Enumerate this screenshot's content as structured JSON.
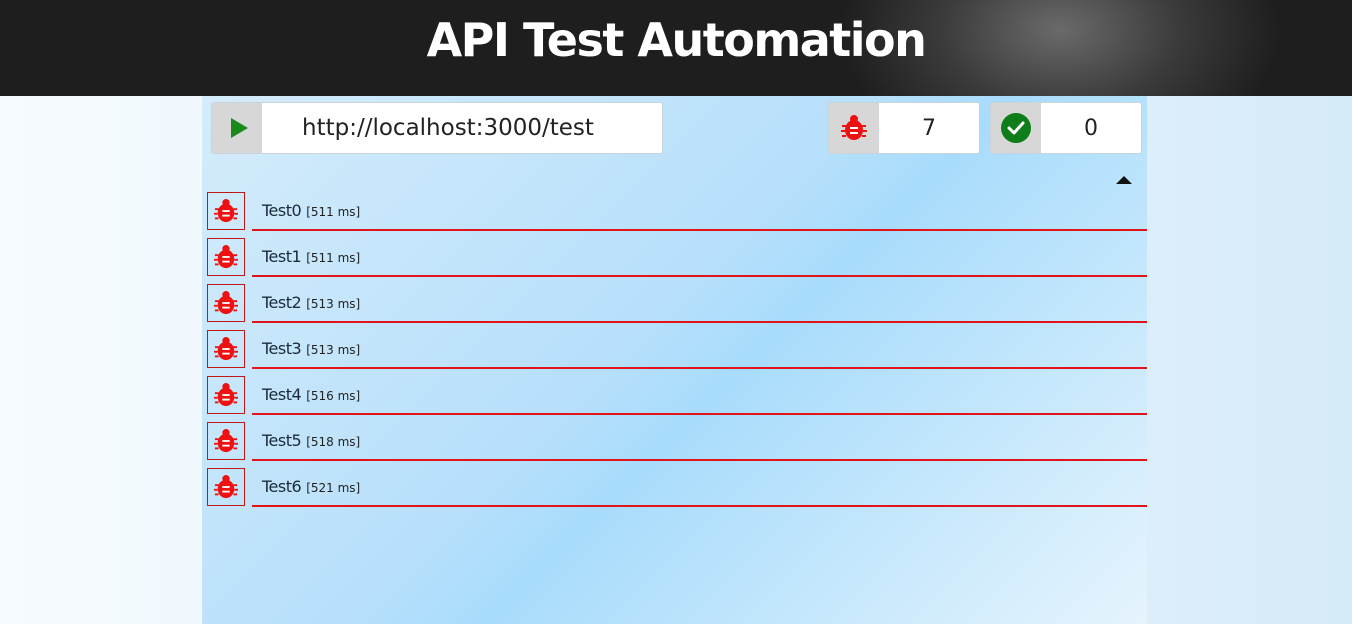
{
  "header": {
    "title": "API Test Automation"
  },
  "toolbar": {
    "url": "http://localhost:3000/test",
    "fail_count": "7",
    "pass_count": "0"
  },
  "colors": {
    "fail": "#ee1111",
    "pass": "#0f7d1a",
    "play": "#1a8a1a"
  },
  "tests": [
    {
      "name": "Test0",
      "time": "[511 ms]",
      "status": "fail"
    },
    {
      "name": "Test1",
      "time": "[511 ms]",
      "status": "fail"
    },
    {
      "name": "Test2",
      "time": "[513 ms]",
      "status": "fail"
    },
    {
      "name": "Test3",
      "time": "[513 ms]",
      "status": "fail"
    },
    {
      "name": "Test4",
      "time": "[516 ms]",
      "status": "fail"
    },
    {
      "name": "Test5",
      "time": "[518 ms]",
      "status": "fail"
    },
    {
      "name": "Test6",
      "time": "[521 ms]",
      "status": "fail"
    }
  ]
}
